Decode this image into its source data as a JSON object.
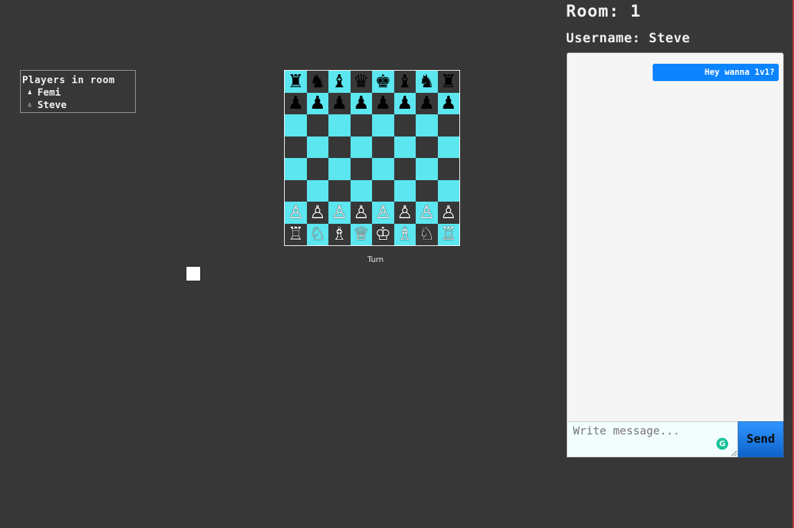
{
  "room": {
    "label": "Room:",
    "value": "1"
  },
  "username": {
    "label": "Username:",
    "value": "Steve"
  },
  "players": {
    "title": "Players in room",
    "list": [
      {
        "name": "Femi",
        "icon": "black-pawn-icon",
        "glyph": "♟"
      },
      {
        "name": "Steve",
        "icon": "white-pawn-icon",
        "glyph": "♙"
      }
    ]
  },
  "board": {
    "light_color": "#5ce6ef",
    "dark_color": "#373737",
    "rows": [
      [
        "♜",
        "♞",
        "♝",
        "♛",
        "♚",
        "♝",
        "♞",
        "♜"
      ],
      [
        "♟",
        "♟",
        "♟",
        "♟",
        "♟",
        "♟",
        "♟",
        "♟"
      ],
      [
        "",
        "",
        "",
        "",
        "",
        "",
        "",
        ""
      ],
      [
        "",
        "",
        "",
        "",
        "",
        "",
        "",
        ""
      ],
      [
        "",
        "",
        "",
        "",
        "",
        "",
        "",
        ""
      ],
      [
        "",
        "",
        "",
        "",
        "",
        "",
        "",
        ""
      ],
      [
        "♙",
        "♙",
        "♙",
        "♙",
        "♙",
        "♙",
        "♙",
        "♙"
      ],
      [
        "♖",
        "♘",
        "♗",
        "♕",
        "♔",
        "♗",
        "♘",
        "♖"
      ]
    ]
  },
  "turn": {
    "label": "Turn"
  },
  "chat": {
    "messages": [
      {
        "text": "Hey wanna 1v1?",
        "color": "#0d84ff"
      }
    ],
    "input_placeholder": "Write message...",
    "send_label": "Send"
  }
}
